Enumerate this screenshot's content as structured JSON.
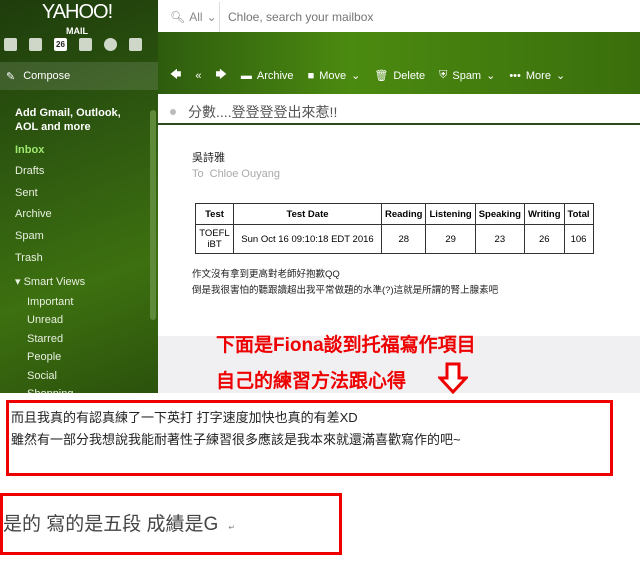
{
  "logo": {
    "brand": "YAHOO!",
    "product": "MAIL"
  },
  "apps": [
    "mail-icon",
    "contacts-icon",
    "calendar-icon",
    "notepad-icon",
    "messenger-icon",
    "newsfeed-icon"
  ],
  "calendar_day": "26",
  "search": {
    "scope": "All",
    "placeholder": "Chloe, search your mailbox"
  },
  "sidebar": {
    "compose": "Compose",
    "add_accounts": "Add Gmail, Outlook, AOL and more",
    "folders": [
      "Inbox",
      "Drafts",
      "Sent",
      "Archive",
      "Spam",
      "Trash"
    ],
    "smart_views": "Smart Views",
    "smart_items": [
      "Important",
      "Unread",
      "Starred",
      "People",
      "Social",
      "Shopping"
    ]
  },
  "toolbar": {
    "archive": "Archive",
    "move": "Move",
    "delete": "Delete",
    "spam": "Spam",
    "more": "More"
  },
  "email": {
    "subject": "分數....登登登登出來惹!!",
    "sender": "吳詩雅",
    "to_label": "To",
    "to_name": "Chloe Ouyang",
    "table": {
      "headers": [
        "Test",
        "Test Date",
        "Reading",
        "Listening",
        "Speaking",
        "Writing",
        "Total"
      ],
      "row": [
        "TOEFL iBT",
        "Sun Oct 16 09:10:18 EDT 2016",
        "28",
        "29",
        "23",
        "26",
        "106"
      ]
    },
    "lines": [
      "作文沒有拿到更高對老師好抱歉QQ",
      "倒是我很害怕的聽跟讀超出我平常做題的水準(?)這就是所謂的腎上腺素吧"
    ]
  },
  "annotation": {
    "line1": "下面是Fiona談到托福寫作項目",
    "line2": "自己的練習方法跟心得",
    "accent": "#e00000"
  },
  "quote1": [
    "而且我真的有認真練了一下英打 打字速度加快也真的有差XD",
    "雖然有一部分我想說我能耐著性子練習很多應該是我本來就還滿喜歡寫作的吧~"
  ],
  "quote2": "是的 寫的是五段 成績是G"
}
